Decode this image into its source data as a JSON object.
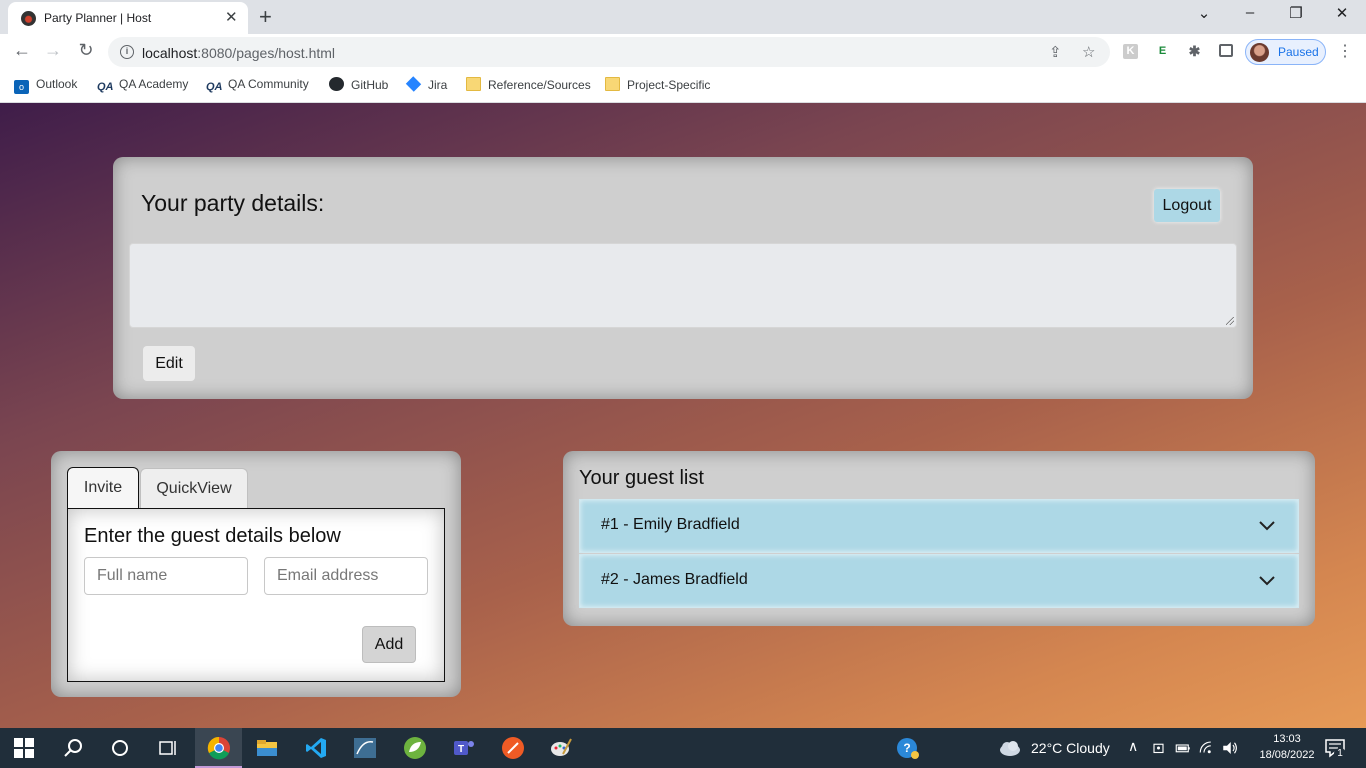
{
  "browser": {
    "tab_title": "Party Planner | Host",
    "url_host": "localhost",
    "url_rest": ":8080/pages/host.html",
    "profile_label": "Paused",
    "bookmarks": [
      {
        "label": "Outlook",
        "icon": "outlook-icon"
      },
      {
        "label": "QA Academy",
        "icon": "qa-icon"
      },
      {
        "label": "QA Community",
        "icon": "qa-icon"
      },
      {
        "label": "GitHub",
        "icon": "github-icon"
      },
      {
        "label": "Jira",
        "icon": "jira-icon"
      },
      {
        "label": "Reference/Sources",
        "icon": "folder-icon"
      },
      {
        "label": "Project-Specific",
        "icon": "folder-icon"
      }
    ]
  },
  "details": {
    "title": "Your party details:",
    "logout_label": "Logout",
    "textarea_value": "",
    "edit_label": "Edit"
  },
  "invite": {
    "tabs": [
      {
        "label": "Invite",
        "active": true
      },
      {
        "label": "QuickView",
        "active": false
      }
    ],
    "heading": "Enter the guest details below",
    "name_placeholder": "Full name",
    "email_placeholder": "Email address",
    "add_label": "Add"
  },
  "guests": {
    "title": "Your guest list",
    "items": [
      {
        "label": "#1 - Emily Bradfield"
      },
      {
        "label": "#2 - James Bradfield"
      }
    ]
  },
  "taskbar": {
    "weather": "22°C  Cloudy",
    "time": "13:03",
    "date": "18/08/2022",
    "notifications": "1"
  },
  "colors": {
    "accent": "#add8e6",
    "panel": "#cfcfcf"
  }
}
